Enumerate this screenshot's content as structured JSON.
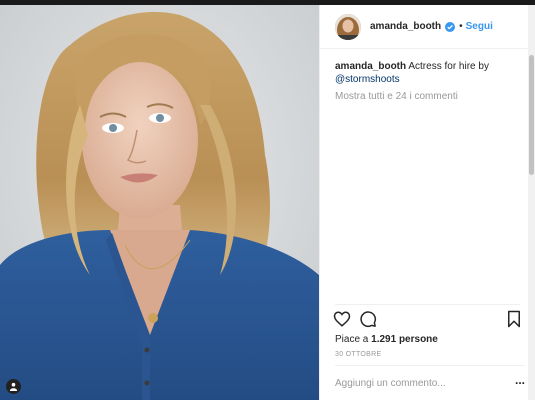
{
  "post": {
    "username": "amanda_booth",
    "separator": "•",
    "follow_label": "Segui",
    "caption_user": "amanda_booth",
    "caption_text": "Actress for hire by",
    "caption_mention": "@stormshoots",
    "view_all_comments": "Mostra tutti e 24 i commenti",
    "likes_prefix": "Piace a ",
    "likes_count": "1.291",
    "likes_suffix": " persone",
    "date": "30 OTTOBRE",
    "comment_placeholder": "Aggiungi un commento...",
    "more_label": "..."
  },
  "icons": {
    "verified": "verified-badge-icon",
    "like": "heart-icon",
    "comment": "comment-bubble-icon",
    "save": "bookmark-icon",
    "user_tag": "user-tag-icon"
  },
  "colors": {
    "follow": "#3897f0",
    "verified": "#3897f0",
    "mention": "#003569",
    "muted": "#999999"
  }
}
